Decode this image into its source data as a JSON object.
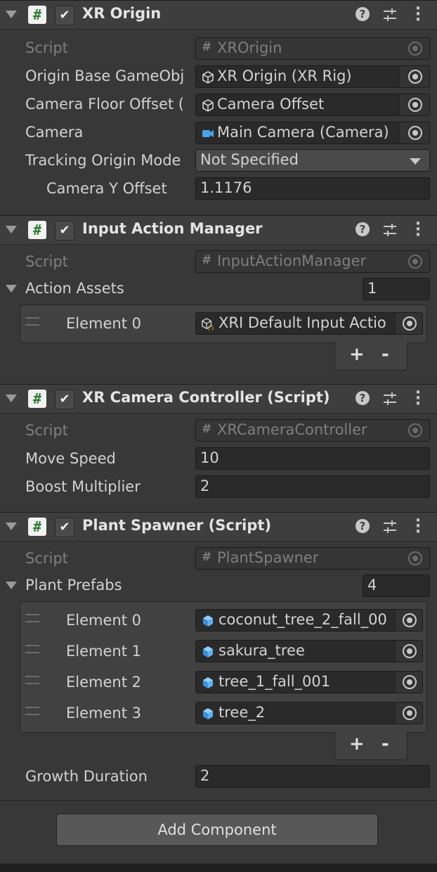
{
  "components": [
    {
      "title": "XR Origin",
      "script_field": {
        "label": "Script",
        "value": "XROrigin"
      },
      "fields": [
        {
          "label": "Origin Base GameObj",
          "value": "XR Origin (XR Rig)",
          "icon": "cube-icon"
        },
        {
          "label": "Camera Floor Offset (",
          "value": "Camera Offset",
          "icon": "cube-icon"
        },
        {
          "label": "Camera",
          "value": "Main Camera (Camera)",
          "icon": "camera-icon"
        },
        {
          "label": "Tracking Origin Mode",
          "value": "Not Specified",
          "type": "dropdown"
        },
        {
          "label": "Camera Y Offset",
          "value": "1.1176",
          "type": "number"
        }
      ]
    },
    {
      "title": "Input Action Manager",
      "script_field": {
        "label": "Script",
        "value": "InputActionManager"
      },
      "list": {
        "label": "Action Assets",
        "size": "1",
        "elements": [
          {
            "label": "Element 0",
            "value": "XRI Default Input Actio",
            "icon": "input-asset-icon"
          }
        ]
      }
    },
    {
      "title": "XR Camera Controller (Script)",
      "script_field": {
        "label": "Script",
        "value": "XRCameraController"
      },
      "fields": [
        {
          "label": "Move Speed",
          "value": "10"
        },
        {
          "label": "Boost Multiplier",
          "value": "2"
        }
      ]
    },
    {
      "title": "Plant Spawner (Script)",
      "script_field": {
        "label": "Script",
        "value": "PlantSpawner"
      },
      "list": {
        "label": "Plant Prefabs",
        "size": "4",
        "elements": [
          {
            "label": "Element 0",
            "value": "coconut_tree_2_fall_00",
            "icon": "prefab-icon"
          },
          {
            "label": "Element 1",
            "value": "sakura_tree",
            "icon": "prefab-icon"
          },
          {
            "label": "Element 2",
            "value": "tree_1_fall_001",
            "icon": "prefab-icon"
          },
          {
            "label": "Element 3",
            "value": "tree_2",
            "icon": "prefab-icon"
          }
        ]
      },
      "fields": [
        {
          "label": "Growth Duration",
          "value": "2"
        }
      ]
    }
  ],
  "list_controls": {
    "add": "+",
    "remove": "-"
  },
  "add_component_label": "Add Component"
}
